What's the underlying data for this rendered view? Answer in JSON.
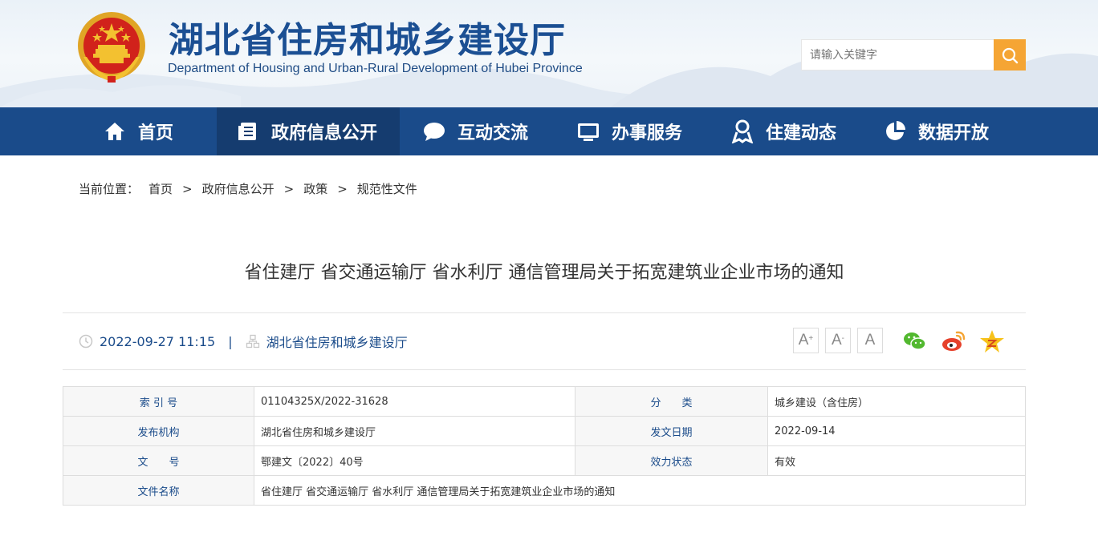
{
  "header": {
    "title": "湖北省住房和城乡建设厅",
    "subtitle": "Department of Housing and Urban-Rural Development of Hubei Province",
    "search_placeholder": "请输入关键字"
  },
  "nav": {
    "items": [
      {
        "label": "首页",
        "icon": "home-icon"
      },
      {
        "label": "政府信息公开",
        "icon": "document-list-icon",
        "active": true
      },
      {
        "label": "互动交流",
        "icon": "chat-bubble-icon"
      },
      {
        "label": "办事服务",
        "icon": "monitor-icon"
      },
      {
        "label": "住建动态",
        "icon": "location-person-icon"
      },
      {
        "label": "数据开放",
        "icon": "pie-chart-icon"
      }
    ]
  },
  "breadcrumb": {
    "label": "当前位置：",
    "items": [
      "首页",
      "政府信息公开",
      "政策",
      "规范性文件"
    ],
    "separator": ">"
  },
  "article": {
    "title": "省住建厅 省交通运输厅 省水利厅 通信管理局关于拓宽建筑业企业市场的通知",
    "datetime": "2022-09-27 11:15",
    "separator": "|",
    "source": "湖北省住房和城乡建设厅",
    "font_sizes": {
      "large": "A",
      "large_mark": "+",
      "small": "A",
      "small_mark": "-",
      "normal": "A"
    },
    "share": [
      "wechat-icon",
      "weibo-icon",
      "qzone-icon"
    ]
  },
  "info_table": {
    "rows": [
      {
        "k1": "索 引 号",
        "v1": "01104325X/2022-31628",
        "k2": "分　　类",
        "v2": "城乡建设（含住房）"
      },
      {
        "k1": "发布机构",
        "v1": "湖北省住房和城乡建设厅",
        "k2": "发文日期",
        "v2": "2022-09-14"
      },
      {
        "k1": "文　　号",
        "v1": "鄂建文〔2022〕40号",
        "k2": "效力状态",
        "v2": "有效"
      }
    ],
    "name_row": {
      "k": "文件名称",
      "v": "省住建厅 省交通运输厅 省水利厅 通信管理局关于拓宽建筑业企业市场的通知"
    }
  },
  "colors": {
    "nav_bg": "#1a4b8a",
    "nav_active": "#153c6f",
    "title_blue": "#1b4f93",
    "search_btn": "#f5a534"
  }
}
